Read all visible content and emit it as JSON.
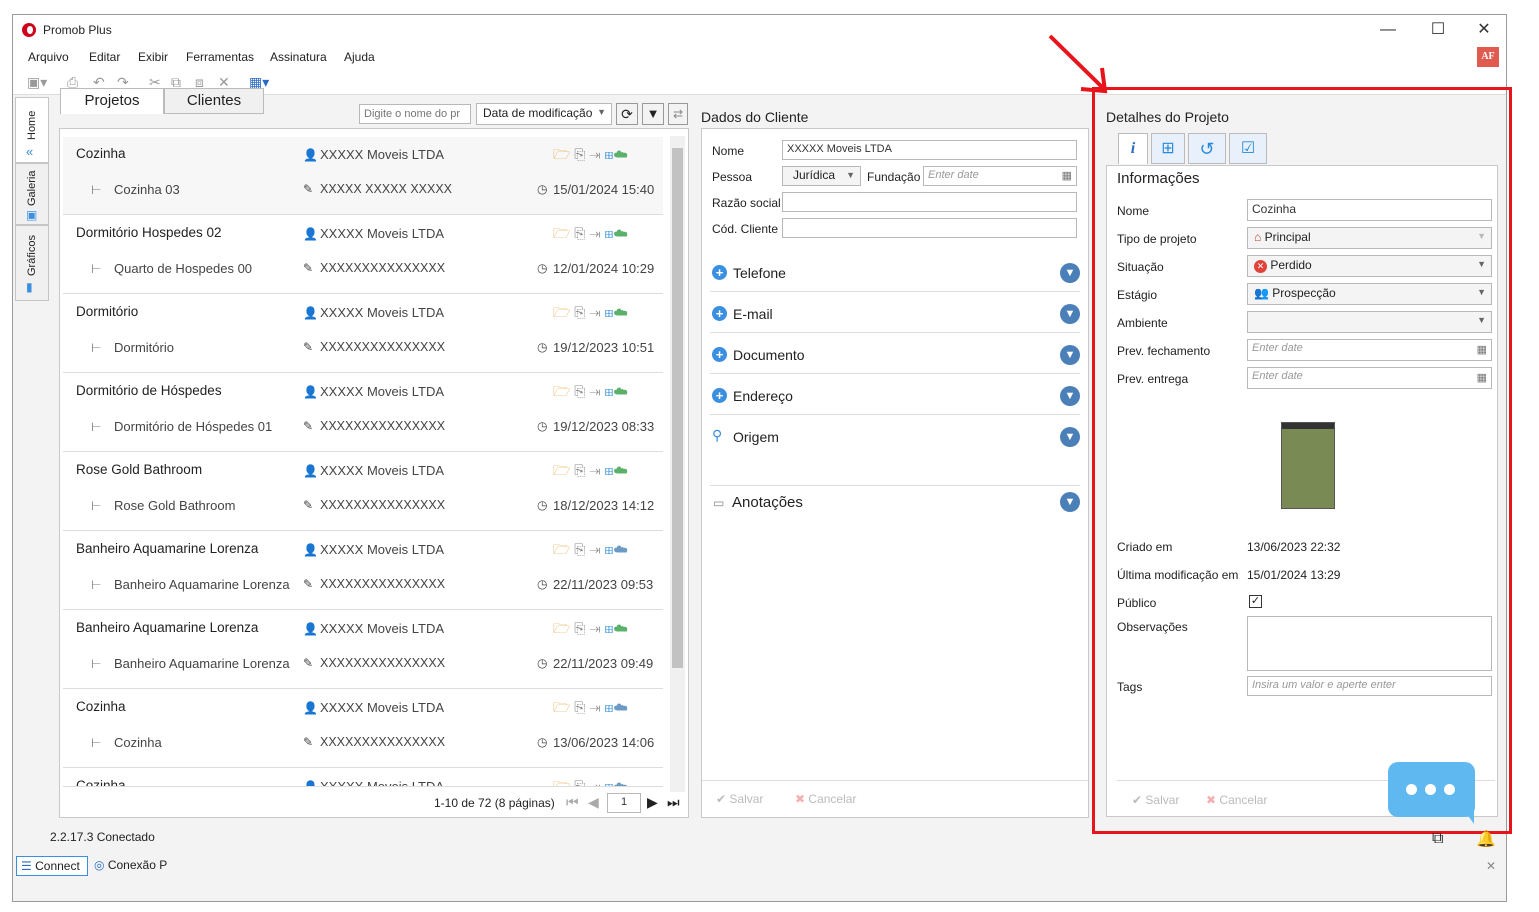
{
  "window": {
    "title": "Promob Plus",
    "minimize": "—",
    "maximize": "☐",
    "close": "✕"
  },
  "menu": [
    "Arquivo",
    "Editar",
    "Exibir",
    "Ferramentas",
    "Assinatura",
    "Ajuda"
  ],
  "user_badge": "AF",
  "side_tabs": [
    "Home",
    "Galeria",
    "Gráficos"
  ],
  "projects_panel": {
    "tabs": [
      "Projetos",
      "Clientes"
    ],
    "search_placeholder": "Digite o nome do pr",
    "sort": "Data de modificação",
    "pagination": {
      "summary": "1-10 de 72 (8 páginas)",
      "page": "1"
    },
    "items": [
      {
        "title": "Cozinha",
        "client": "XXXXX Moveis LTDA",
        "sub": "Cozinha 03",
        "author": "XXXXX XXXXX XXXXX",
        "date": "15/01/2024 15:40"
      },
      {
        "title": "Dormitório Hospedes 02",
        "client": "XXXXX Moveis LTDA",
        "sub": "Quarto de Hospedes 00",
        "author": "XXXXXXXXXXXXXXX",
        "date": "12/01/2024 10:29"
      },
      {
        "title": "Dormitório",
        "client": "XXXXX Moveis LTDA",
        "sub": "Dormitório",
        "author": "XXXXXXXXXXXXXXX",
        "date": "19/12/2023 10:51"
      },
      {
        "title": "Dormitório de Hóspedes",
        "client": "XXXXX Moveis LTDA",
        "sub": "Dormitório de Hóspedes 01",
        "author": "XXXXXXXXXXXXXXX",
        "date": "19/12/2023 08:33"
      },
      {
        "title": "Rose Gold Bathroom",
        "client": "XXXXX Moveis LTDA",
        "sub": "Rose Gold Bathroom",
        "author": "XXXXXXXXXXXXXXX",
        "date": "18/12/2023 14:12"
      },
      {
        "title": "Banheiro Aquamarine Lorenza",
        "client": "XXXXX Moveis LTDA",
        "sub": "Banheiro Aquamarine Lorenza",
        "author": "XXXXXXXXXXXXXXX",
        "date": "22/11/2023 09:53"
      },
      {
        "title": "Banheiro Aquamarine Lorenza",
        "client": "XXXXX Moveis LTDA",
        "sub": "Banheiro Aquamarine Lorenza",
        "author": "XXXXXXXXXXXXXXX",
        "date": "22/11/2023 09:49"
      },
      {
        "title": "Cozinha",
        "client": "XXXXX Moveis LTDA",
        "sub": "Cozinha",
        "author": "XXXXXXXXXXXXXXX",
        "date": "13/06/2023 14:06"
      },
      {
        "title": "Cozinha",
        "client": "XXXXX Moveis LTDA",
        "sub": "",
        "author": "",
        "date": ""
      }
    ]
  },
  "client_panel": {
    "title": "Dados do Cliente",
    "labels": {
      "nome": "Nome",
      "pessoa": "Pessoa",
      "fundacao": "Fundação",
      "razao": "Razão social",
      "cod": "Cód. Cliente"
    },
    "nome": "XXXXX Moveis LTDA",
    "pessoa": "Jurídica",
    "fundacao_placeholder": "Enter date",
    "sections": [
      "Telefone",
      "E-mail",
      "Documento",
      "Endereço",
      "Origem"
    ],
    "notes": "Anotações",
    "save": "Salvar",
    "cancel": "Cancelar"
  },
  "details_panel": {
    "title": "Detalhes do Projeto",
    "section": "Informações",
    "labels": {
      "nome": "Nome",
      "tipo": "Tipo de projeto",
      "situacao": "Situação",
      "estagio": "Estágio",
      "ambiente": "Ambiente",
      "prev_fech": "Prev. fechamento",
      "prev_ent": "Prev. entrega",
      "criado": "Criado em",
      "ultima": "Última modificação em",
      "publico": "Público",
      "obs": "Observações",
      "tags": "Tags"
    },
    "nome": "Cozinha",
    "tipo": "Principal",
    "situacao": "Perdido",
    "estagio": "Prospecção",
    "date_placeholder": "Enter date",
    "criado": "13/06/2023 22:32",
    "ultima": "15/01/2024 13:29",
    "tags_placeholder": "Insira um valor e aperte enter",
    "save": "Salvar",
    "cancel": "Cancelar"
  },
  "status": {
    "version": "2.2.17.3 Conectado",
    "connect": "Connect",
    "conexao": "Conexão P"
  },
  "colors": {
    "highlight": "#e8141c",
    "accent": "#3a8fe0",
    "chat": "#5fb8f0"
  }
}
